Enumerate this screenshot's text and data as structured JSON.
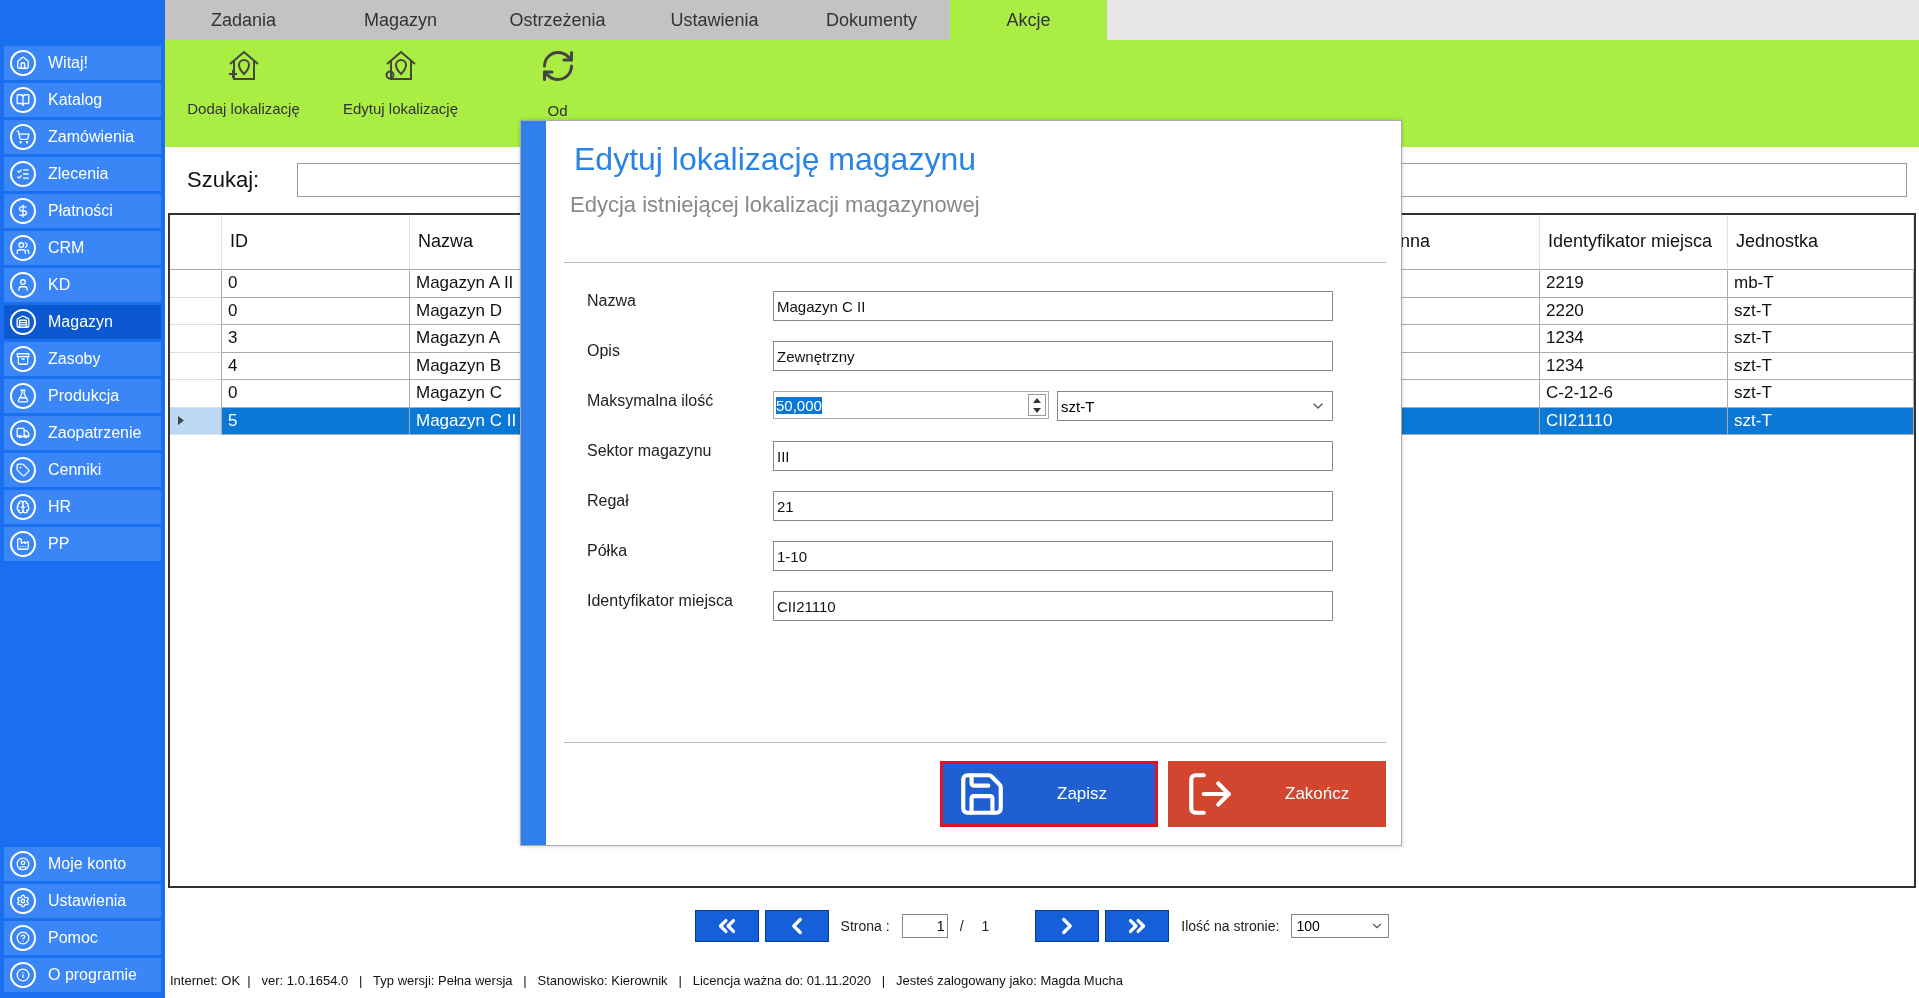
{
  "sidebar": {
    "items": [
      {
        "label": "Witaj!",
        "selected": false
      },
      {
        "label": "Katalog",
        "selected": false
      },
      {
        "label": "Zamówienia",
        "selected": false
      },
      {
        "label": "Zlecenia",
        "selected": false
      },
      {
        "label": "Płatności",
        "selected": false
      },
      {
        "label": "CRM",
        "selected": false
      },
      {
        "label": "KD",
        "selected": false
      },
      {
        "label": "Magazyn",
        "selected": true
      },
      {
        "label": "Zasoby",
        "selected": false
      },
      {
        "label": "Produkcja",
        "selected": false
      },
      {
        "label": "Zaopatrzenie",
        "selected": false
      },
      {
        "label": "Cenniki",
        "selected": false
      },
      {
        "label": "HR",
        "selected": false
      },
      {
        "label": "PP",
        "selected": false
      }
    ],
    "bottom_items": [
      {
        "label": "Moje konto"
      },
      {
        "label": "Ustawienia"
      },
      {
        "label": "Pomoc"
      },
      {
        "label": "O programie"
      }
    ]
  },
  "tabs": [
    {
      "label": "Zadania",
      "selected": false
    },
    {
      "label": "Magazyn",
      "selected": false
    },
    {
      "label": "Ostrzeżenia",
      "selected": false
    },
    {
      "label": "Ustawienia",
      "selected": false
    },
    {
      "label": "Dokumenty",
      "selected": false
    },
    {
      "label": "Akcje",
      "selected": true
    }
  ],
  "toolbar": {
    "actions": [
      {
        "label": "Dodaj lokalizację"
      },
      {
        "label": "Edytuj lokalizację"
      },
      {
        "label": "Od"
      }
    ]
  },
  "search": {
    "label": "Szukaj:"
  },
  "table": {
    "columns": [
      "ID",
      "Nazwa",
      "nna",
      "Identyfikator miejsca",
      "Jednostka"
    ],
    "rows": [
      {
        "id": "0",
        "name": "Magazyn A II",
        "place_id": "2219",
        "unit": "mb-T",
        "selected": false
      },
      {
        "id": "0",
        "name": "Magazyn D",
        "place_id": "2220",
        "unit": "szt-T",
        "selected": false
      },
      {
        "id": "3",
        "name": "Magazyn A",
        "place_id": "1234",
        "unit": "szt-T",
        "selected": false
      },
      {
        "id": "4",
        "name": "Magazyn B",
        "place_id": "1234",
        "unit": "szt-T",
        "selected": false
      },
      {
        "id": "0",
        "name": "Magazyn C",
        "place_id": "C-2-12-6",
        "unit": "szt-T",
        "selected": false
      },
      {
        "id": "5",
        "name": "Magazyn C II",
        "place_id": "CII21110",
        "unit": "szt-T",
        "selected": true
      }
    ]
  },
  "dialog": {
    "title": "Edytuj lokalizację magazynu",
    "subtitle": "Edycja istniejącej lokalizacji magazynowej",
    "fields": [
      {
        "kind": "text",
        "label": "Nazwa",
        "value": "Magazyn C II"
      },
      {
        "kind": "text",
        "label": "Opis",
        "value": "Zewnętrzny"
      },
      {
        "kind": "quantity",
        "label": "Maksymalna ilość",
        "value": "50,000",
        "highlighted": true,
        "unit": "szt-T"
      },
      {
        "kind": "text",
        "label": "Sektor magazynu",
        "value": "III"
      },
      {
        "kind": "text",
        "label": "Regał",
        "value": "21"
      },
      {
        "kind": "text",
        "label": "Półka",
        "value": "1-10"
      },
      {
        "kind": "text",
        "label": "Identyfikator miejsca",
        "value": "CII21110"
      }
    ],
    "buttons": [
      {
        "kind": "save",
        "label": "Zapisz",
        "focused": true
      },
      {
        "kind": "exit",
        "label": "Zakończ",
        "focused": false
      }
    ]
  },
  "pagination": {
    "page_label": "Strona :",
    "page": "1",
    "separator": "/",
    "total": "1",
    "per_page_label": "Ilość na stronie:",
    "per_page": "100"
  },
  "status_bar": "Internet: OK  |   ver: 1.0.1654.0   |   Typ wersji: Pełna wersja   |   Stanowisko: Kierownik   |   Licencja ważna do: 01.11.2020   |   Jesteś zalogowany jako: Magda Mucha"
}
